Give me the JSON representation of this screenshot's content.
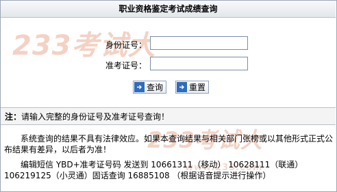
{
  "header": {
    "title": "职业资格鉴定考试成绩查询"
  },
  "watermark": {
    "main": "233考试大",
    "bottom": "233考试大",
    "bottom_small": "www.233.com"
  },
  "form": {
    "id_label": "身份证号：",
    "id_value": "",
    "ticket_label": "准考证号：",
    "ticket_value": "",
    "query_button": "查询",
    "reset_button": "重置"
  },
  "notice": {
    "prefix": "注：",
    "text": "请输入完整的身份证号及准考证号查询！"
  },
  "body": {
    "disclaimer": "系统查询的结果不具有法律效应。如果本查询结果与相关部门张榜或以其他形式正式公布结果有差异，以后者为准！",
    "sms": "编辑短信 YBD+准考证号码 发送到 10661311（移动） 10628111（联通） 106219125（小灵通）固话查询 16885108 （根据语音提示进行操作）"
  },
  "colors": {
    "border": "#9aa6b6",
    "button_icon": "#2d6cc0",
    "watermark": "#f3d2c4"
  }
}
